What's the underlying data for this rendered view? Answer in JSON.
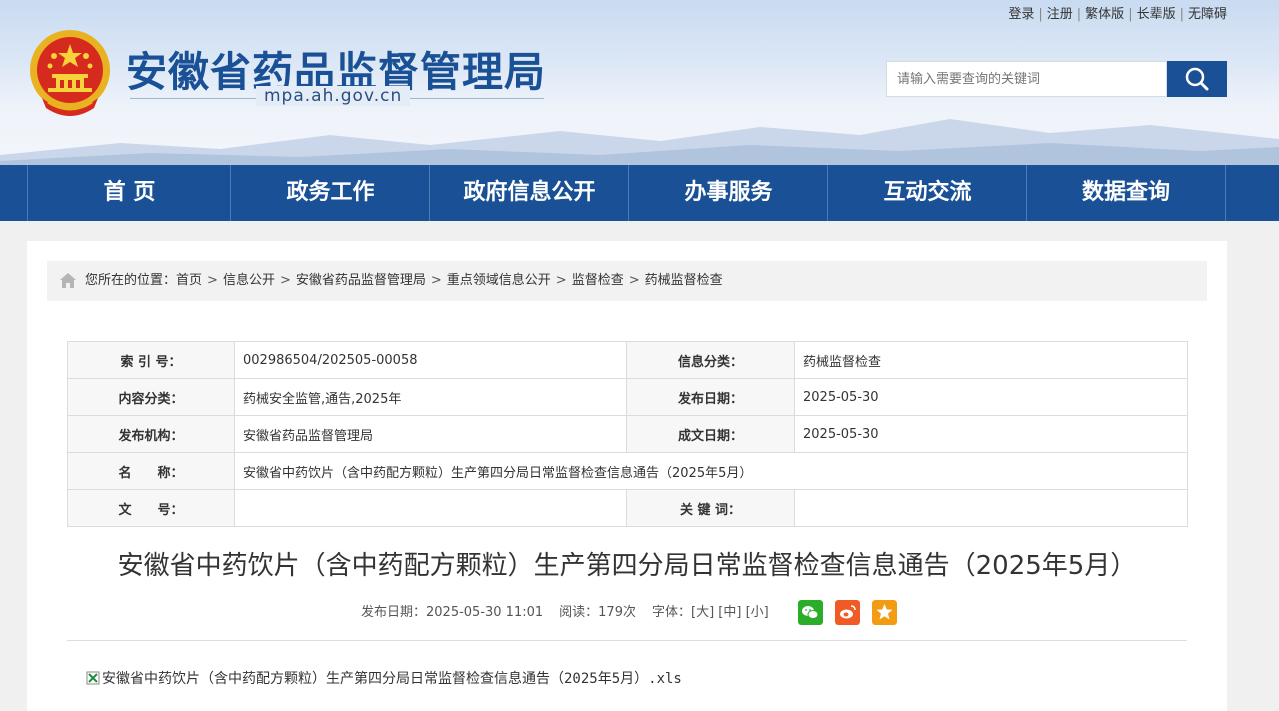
{
  "header": {
    "top_links": [
      "登录",
      "注册",
      "繁体版",
      "长辈版",
      "无障碍"
    ],
    "site_title": "安徽省药品监督管理局",
    "site_domain": "mpa.ah.gov.cn",
    "search_placeholder": "请输入需要查询的关键词"
  },
  "nav": {
    "items": [
      "首 页",
      "政务工作",
      "政府信息公开",
      "办事服务",
      "互动交流",
      "数据查询"
    ]
  },
  "breadcrumb": {
    "prefix": "您所在的位置：",
    "items": [
      "首页",
      "信息公开",
      "安徽省药品监督管理局",
      "重点领域信息公开",
      "监督检查",
      "药械监督检查"
    ],
    "separator": ">"
  },
  "info_table": {
    "index_label": "索 引 号：",
    "index_value": "002986504/202505-00058",
    "category_label": "信息分类：",
    "category_value": "药械监督检查",
    "content_label": "内容分类：",
    "content_value": "药械安全监管,通告,2025年",
    "publish_date_label": "发布日期：",
    "publish_date_value": "2025-05-30",
    "org_label": "发布机构：",
    "org_value": "安徽省药品监督管理局",
    "written_date_label": "成文日期：",
    "written_date_value": "2025-05-30",
    "name_label": "名　　称：",
    "name_value": "安徽省中药饮片（含中药配方颗粒）生产第四分局日常监督检查信息通告（2025年5月）",
    "docno_label": "文　　号：",
    "docno_value": "",
    "keyword_label": "关 键 词：",
    "keyword_value": ""
  },
  "article": {
    "title": "安徽省中药饮片（含中药配方颗粒）生产第四分局日常监督检查信息通告（2025年5月）",
    "publish_info": "发布日期：2025-05-30 11:01",
    "read_count": "阅读：179次",
    "font_label": "字体：",
    "font_large": "[大]",
    "font_medium": "[中]",
    "font_small": "[小]",
    "share_icons": [
      "wechat-icon",
      "weibo-icon",
      "favorite-star-icon"
    ],
    "attachment": "安徽省中药饮片（含中药配方颗粒）生产第四分局日常监督检查信息通告（2025年5月）.xls"
  },
  "colors": {
    "brand_blue": "#1a5196",
    "wechat_green": "#2aae2a",
    "weibo_orange": "#f05a24",
    "star_orange": "#f39c12"
  }
}
